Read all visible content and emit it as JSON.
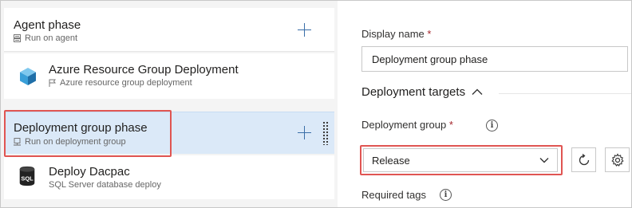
{
  "phases": {
    "agent": {
      "title": "Agent phase",
      "subtitle": "Run on agent",
      "icon": "server-icon"
    },
    "task_arm": {
      "title": "Azure Resource Group Deployment",
      "subtitle": "Azure resource group deployment",
      "icon": "azure-cube-icon",
      "sub_icon": "flag-icon"
    },
    "deployment_group": {
      "title": "Deployment group phase",
      "subtitle": "Run on deployment group",
      "icon": "deployment-group-icon",
      "selected": true
    },
    "task_dacpac": {
      "title": "Deploy Dacpac",
      "subtitle": "SQL Server database deploy",
      "icon": "sql-database-icon",
      "icon_text": "SQL"
    }
  },
  "details": {
    "display_name_label": "Display name",
    "required_mark": "*",
    "display_name_value": "Deployment group phase",
    "section_title": "Deployment targets",
    "deployment_group_label": "Deployment group",
    "deployment_group_value": "Release",
    "required_tags_label": "Required tags",
    "info_glyph": "i"
  },
  "colors": {
    "selected_row": "#dbe9f8",
    "highlight_border": "#e05552",
    "accent_plus": "#3a6ea8",
    "required": "#a4262c"
  }
}
